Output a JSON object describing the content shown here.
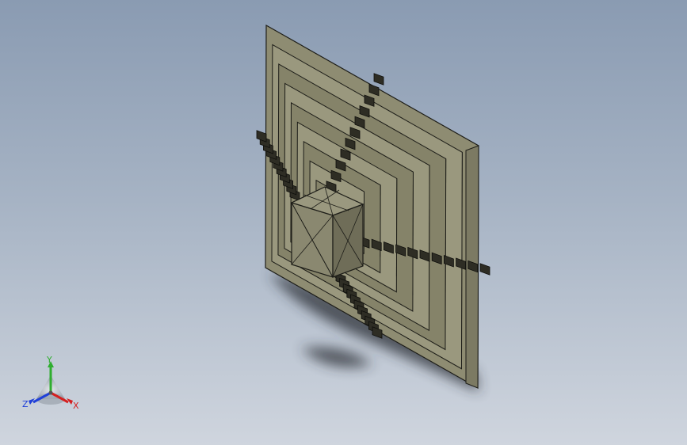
{
  "viewport": {
    "background_top": "#8a9bb2",
    "background_bottom": "#cfd5de"
  },
  "model": {
    "face_color": "#8e8c72",
    "face_dark": "#6f6d58",
    "edge_color": "#1d1d18",
    "shadow_color": "#2b2f36",
    "ring_count": 8,
    "slot_count_per_arm": 11
  },
  "triad": {
    "icon": "reference-triad-icon",
    "x_label": "X",
    "y_label": "Y",
    "z_label": "Z",
    "x_color": "#d42020",
    "y_color": "#2fae2f",
    "z_color": "#2040d8"
  }
}
